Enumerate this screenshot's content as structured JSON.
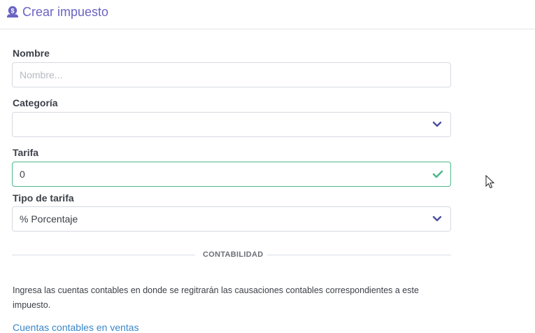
{
  "header": {
    "icon": "money-bag-icon",
    "title": "Crear impuesto"
  },
  "form": {
    "nombre": {
      "label": "Nombre",
      "placeholder": "Nombre...",
      "value": ""
    },
    "categoria": {
      "label": "Categoría",
      "value": ""
    },
    "tarifa": {
      "label": "Tarifa",
      "value": "0"
    },
    "tipo_tarifa": {
      "label": "Tipo de tarifa",
      "value": "% Porcentaje"
    }
  },
  "section": {
    "title": "CONTABILIDAD"
  },
  "description": "Ingresa las cuentas contables en donde se regitrarán las causaciones contables correspondientes a este impuesto.",
  "link": {
    "label": "Cuentas contables en ventas"
  },
  "colors": {
    "accent": "#6a64c4",
    "valid": "#4cb98a",
    "link": "#3a87c8"
  }
}
